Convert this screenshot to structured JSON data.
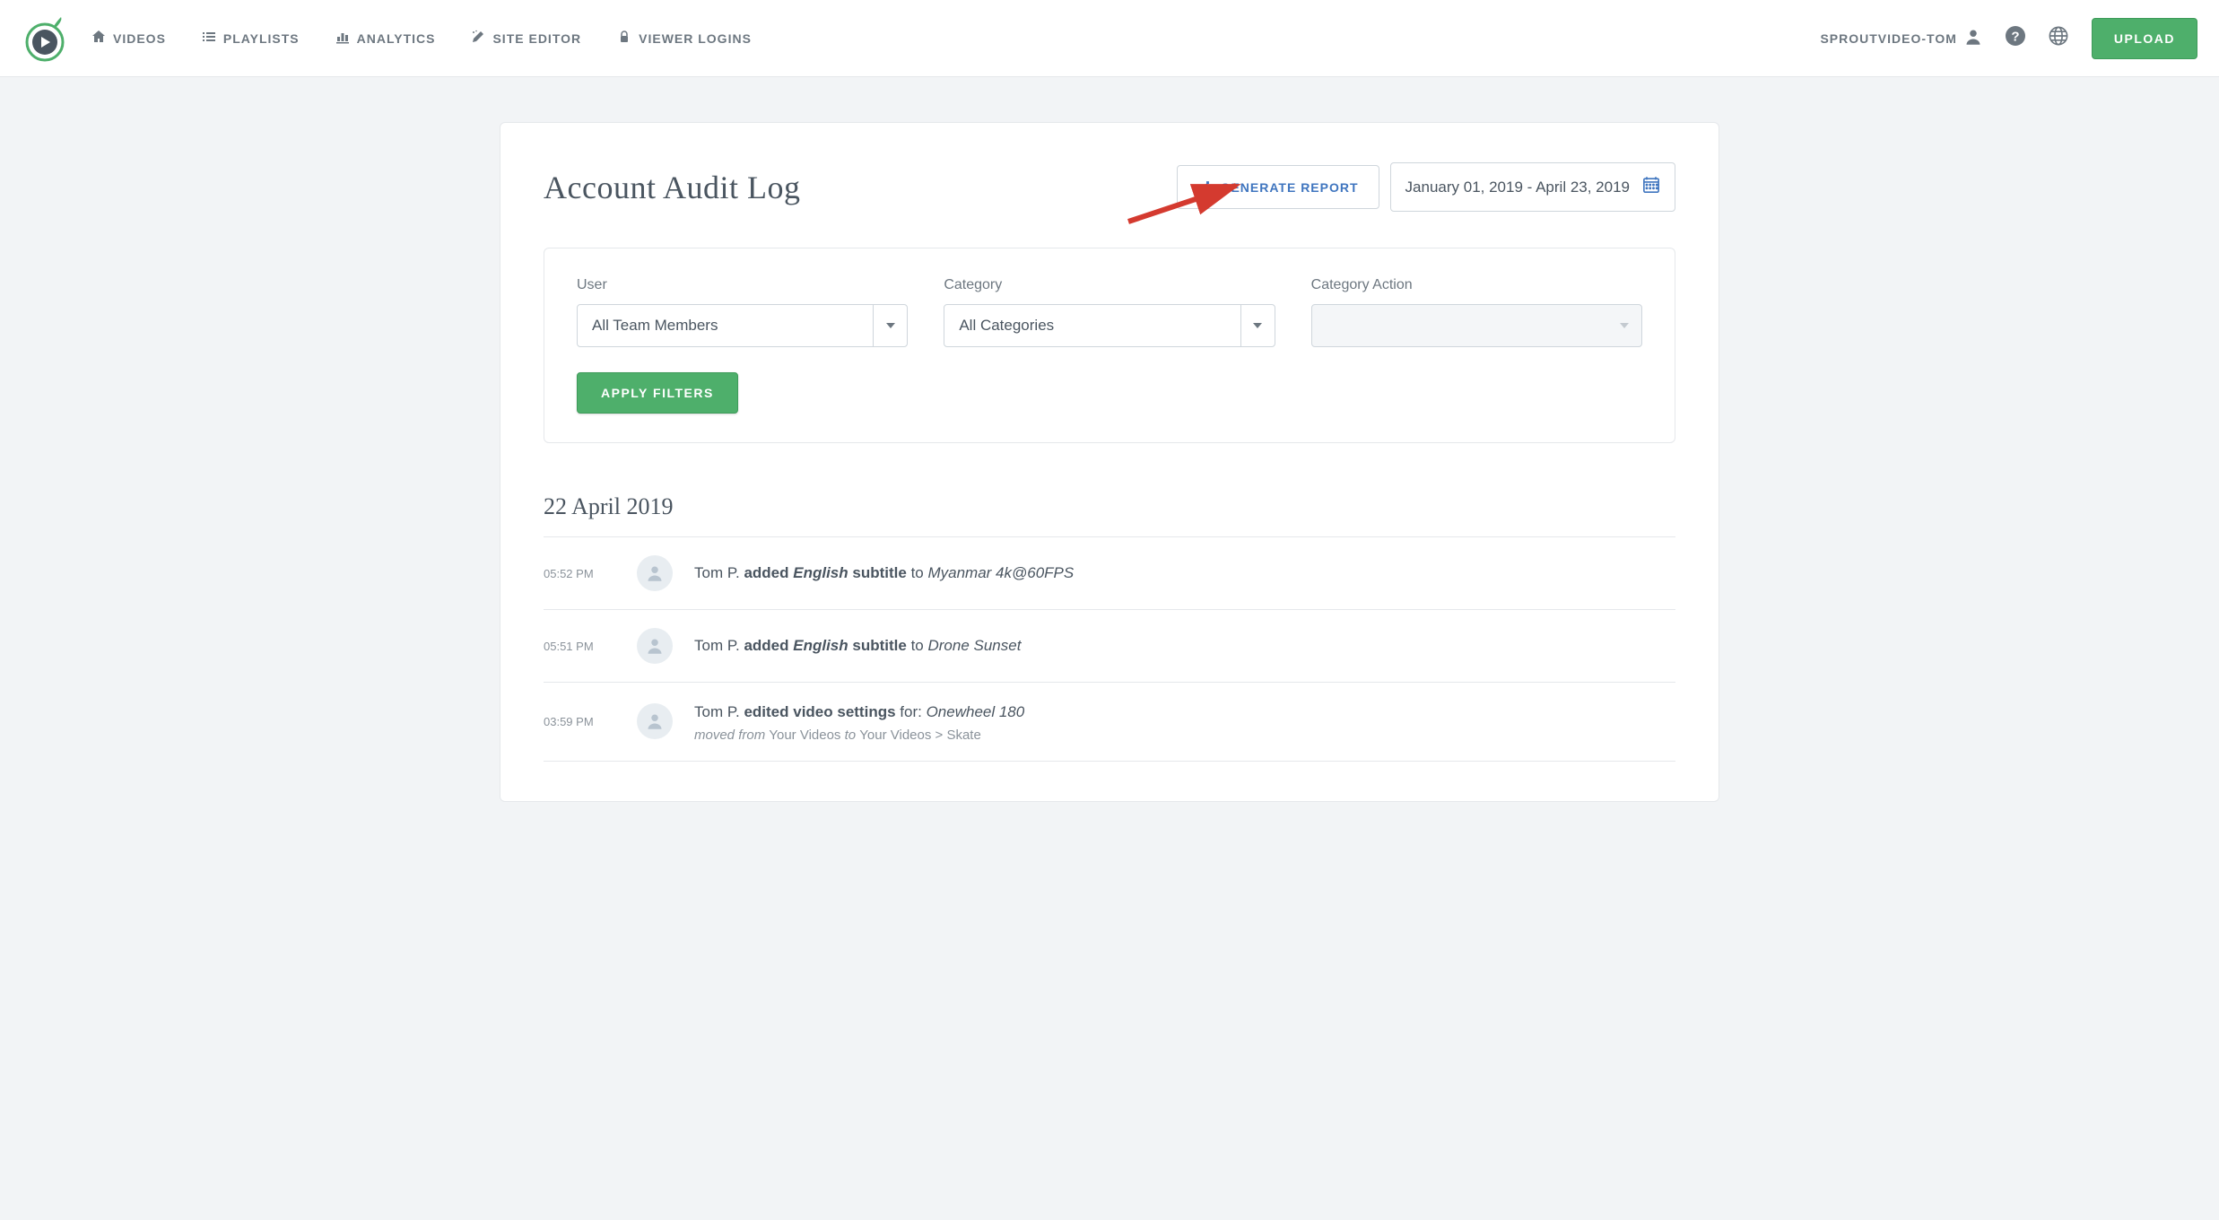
{
  "nav": {
    "videos": "VIDEOS",
    "playlists": "PLAYLISTS",
    "analytics": "ANALYTICS",
    "site_editor": "SITE EDITOR",
    "viewer_logins": "VIEWER LOGINS",
    "user": "SPROUTVIDEO-TOM",
    "upload": "UPLOAD"
  },
  "page": {
    "title": "Account Audit Log",
    "generate_report": "GENERATE REPORT",
    "date_range": "January 01, 2019 - April 23, 2019"
  },
  "filters": {
    "user_label": "User",
    "user_value": "All Team Members",
    "category_label": "Category",
    "category_value": "All Categories",
    "action_label": "Category Action",
    "apply": "APPLY FILTERS"
  },
  "log": {
    "date_heading": "22 April 2019",
    "entries": [
      {
        "time": "05:52 PM",
        "user": "Tom P.",
        "action": "added",
        "detail_bold": "English",
        "detail_suffix": " subtitle",
        "to_label": " to ",
        "target": "Myanmar 4k@60FPS"
      },
      {
        "time": "05:51 PM",
        "user": "Tom P.",
        "action": "added",
        "detail_bold": "English",
        "detail_suffix": " subtitle",
        "to_label": " to ",
        "target": "Drone Sunset"
      },
      {
        "time": "03:59 PM",
        "user": "Tom P.",
        "action": "edited video settings",
        "for_label": " for: ",
        "target": "Onewheel 180",
        "sub_moved_from": "moved from ",
        "sub_from": "Your Videos",
        "sub_to_label": " to ",
        "sub_to": "Your Videos > Skate"
      }
    ]
  }
}
